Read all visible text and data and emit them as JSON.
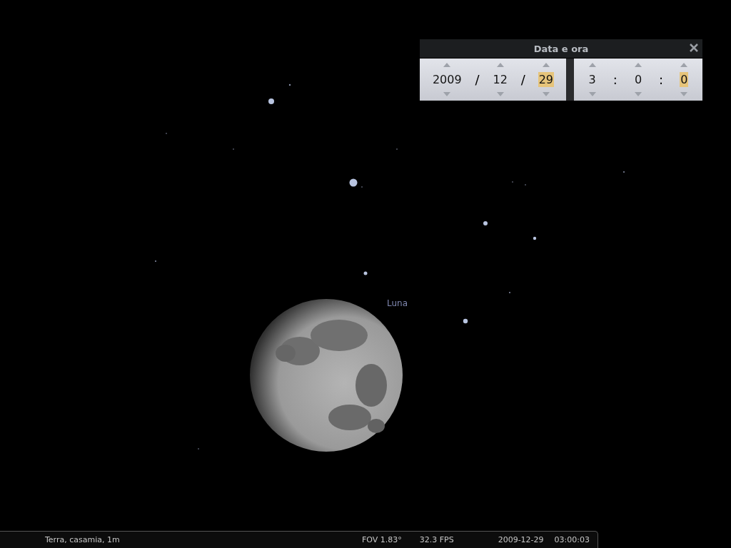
{
  "sky": {
    "object_label": "Luna"
  },
  "date_time_dialog": {
    "title": "Data e ora",
    "date_fields": [
      {
        "value": "2009",
        "selected": false
      },
      {
        "value": "12",
        "selected": false
      },
      {
        "value": "29",
        "selected": true
      }
    ],
    "date_separators": [
      "/",
      "/"
    ],
    "time_fields": [
      {
        "value": "3",
        "selected": false
      },
      {
        "value": "0",
        "selected": false
      },
      {
        "value": "0",
        "selected": true
      }
    ],
    "time_separators": [
      ":",
      ":"
    ]
  },
  "status_bar": {
    "location": "Terra, casamia, 1m",
    "fov": "FOV 1.83°",
    "fps": "32.3 FPS",
    "date": "2009-12-29",
    "time": "03:00:03"
  }
}
